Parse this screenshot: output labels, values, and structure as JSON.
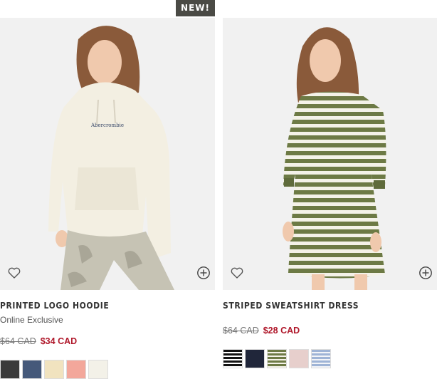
{
  "products": [
    {
      "badge": "NEW!",
      "name": "PRINTED LOGO HOODIE",
      "subtitle": "Online Exclusive",
      "old_price": "$64 CAD",
      "sale_price": "$34 CAD",
      "hoodie_text": "Abercrombie",
      "swatch_colors": [
        "#3a3a3a",
        "#45597a",
        "#f1e3bf",
        "#f3a79b",
        "#f3f1e8"
      ]
    },
    {
      "name": "STRIPED SWEATSHIRT DRESS",
      "old_price": "$64 CAD",
      "sale_price": "$28 CAD",
      "swatch_colors": [
        "stripe-black",
        "#20263a",
        "stripe-olive",
        "#e7cfcc",
        "stripe-blue"
      ]
    }
  ],
  "icons": {
    "wishlist": "heart-icon",
    "quick_add": "plus-circle-icon"
  },
  "colors": {
    "sale": "#b0182b",
    "badge_bg": "#4a4a45",
    "photo_bg": "#f1f1f1"
  }
}
